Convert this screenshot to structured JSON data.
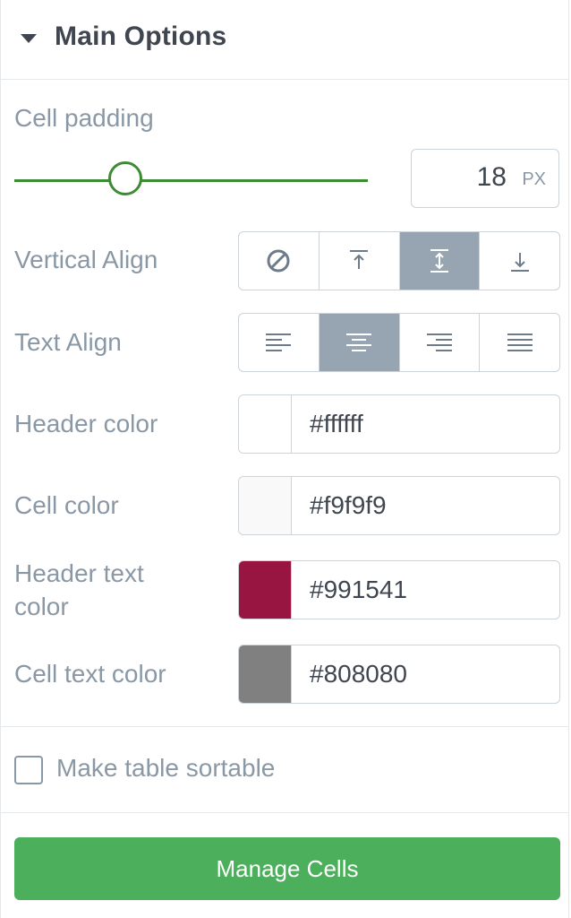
{
  "section": {
    "title": "Main Options"
  },
  "cell_padding": {
    "label": "Cell padding",
    "value": "18",
    "unit": "PX",
    "slider_fraction": 0.32
  },
  "vertical_align": {
    "label": "Vertical Align",
    "options": [
      "none",
      "top",
      "middle",
      "bottom"
    ],
    "selected": "middle"
  },
  "text_align": {
    "label": "Text Align",
    "options": [
      "left",
      "center",
      "right",
      "justify"
    ],
    "selected": "center"
  },
  "colors": {
    "header": {
      "label": "Header color",
      "value": "#ffffff",
      "swatch": "#ffffff"
    },
    "cell": {
      "label": "Cell color",
      "value": "#f9f9f9",
      "swatch": "#f9f9f9"
    },
    "header_text": {
      "label_line1": "Header text",
      "label_line2": "color",
      "value": "#991541",
      "swatch": "#991541"
    },
    "cell_text": {
      "label": "Cell text color",
      "value": "#808080",
      "swatch": "#808080"
    }
  },
  "sortable": {
    "label": "Make table sortable",
    "checked": false
  },
  "actions": {
    "manage_cells": "Manage Cells"
  },
  "theme": {
    "accent": "#4caf5c",
    "slider": "#3d8b34",
    "active_segment": "#97a5b2"
  }
}
